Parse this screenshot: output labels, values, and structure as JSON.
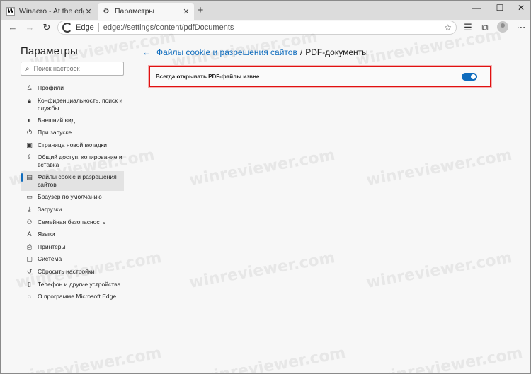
{
  "tabs": [
    {
      "title": "Winaero - At the edge of tweaking",
      "favicon": "W",
      "active": false
    },
    {
      "title": "Параметры",
      "favicon": "gear-icon",
      "active": true
    }
  ],
  "toolbar": {
    "site_label": "Edge",
    "url": "edge://settings/content/pdfDocuments"
  },
  "sidebar": {
    "title": "Параметры",
    "search_placeholder": "Поиск настроек",
    "items": [
      {
        "label": "Профили",
        "icon": "profile-icon"
      },
      {
        "label": "Конфиденциальность, поиск и службы",
        "icon": "lock-icon"
      },
      {
        "label": "Внешний вид",
        "icon": "palette-icon"
      },
      {
        "label": "При запуске",
        "icon": "power-icon"
      },
      {
        "label": "Страница новой вкладки",
        "icon": "newtab-icon"
      },
      {
        "label": "Общий доступ, копирование и вставка",
        "icon": "share-icon"
      },
      {
        "label": "Файлы cookie и разрешения сайтов",
        "icon": "cookie-icon",
        "selected": true
      },
      {
        "label": "Браузер по умолчанию",
        "icon": "browser-icon"
      },
      {
        "label": "Загрузки",
        "icon": "download-icon"
      },
      {
        "label": "Семейная безопасность",
        "icon": "family-icon"
      },
      {
        "label": "Языки",
        "icon": "language-icon"
      },
      {
        "label": "Принтеры",
        "icon": "printer-icon"
      },
      {
        "label": "Система",
        "icon": "system-icon"
      },
      {
        "label": "Сбросить настройки",
        "icon": "reset-icon"
      },
      {
        "label": "Телефон и другие устройства",
        "icon": "phone-icon"
      },
      {
        "label": "О программе Microsoft Edge",
        "icon": "edge-icon"
      }
    ]
  },
  "main": {
    "breadcrumb_parent": "Файлы cookie и разрешения сайтов",
    "breadcrumb_separator": "/",
    "breadcrumb_current": "PDF-документы",
    "setting_label": "Всегда открывать PDF-файлы извне",
    "setting_enabled": true
  },
  "watermark": "winreviewer.com",
  "colors": {
    "accent": "#0f6cbd",
    "highlight_border": "#e01010"
  }
}
